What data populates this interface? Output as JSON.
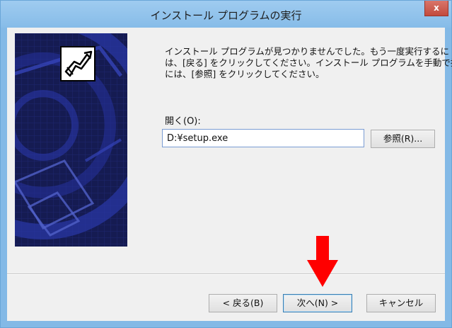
{
  "window": {
    "title": "インストール プログラムの実行",
    "close_label": "x"
  },
  "message": {
    "lines": [
      "インストール プログラムが見つかりませんでした。もう一度実行するに",
      "は、[戻る] をクリックしてください。インストール プログラムを手動で探す",
      "には、[参照] をクリックしてください。"
    ]
  },
  "open_field": {
    "label": "開く(O):",
    "value": "D:¥setup.exe"
  },
  "buttons": {
    "browse": "参照(R)...",
    "back": "< 戻る(B)",
    "next": "次へ(N) >",
    "cancel": "キャンセル"
  },
  "icons": {
    "banner": "setup-icon",
    "annotation": "down-arrow-icon"
  },
  "colors": {
    "titlebar": "#86bce8",
    "banner_background": "#151b52",
    "annotation_arrow": "#ff0000",
    "close_button": "#c24a3d"
  }
}
